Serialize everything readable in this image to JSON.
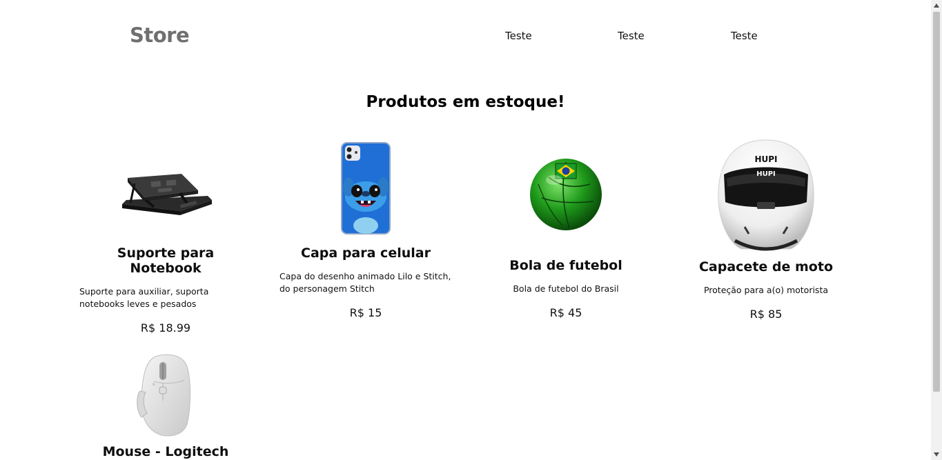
{
  "header": {
    "logo": "Store",
    "nav": [
      "Teste",
      "Teste",
      "Teste"
    ]
  },
  "main": {
    "title": "Produtos em estoque!"
  },
  "products": [
    {
      "name": "Suporte para Notebook",
      "description": "Suporte para auxiliar, suporta notebooks leves e pesados",
      "price": "R$ 18.99",
      "image_icon": "notebook-stand-icon"
    },
    {
      "name": "Capa para celular",
      "description": "Capa do desenho animado Lilo e Stitch, do personagem Stitch",
      "price": "R$ 15",
      "image_icon": "phone-case-icon"
    },
    {
      "name": "Bola de futebol",
      "description": "Bola de futebol do Brasil",
      "price": "R$ 45",
      "image_icon": "soccer-ball-icon"
    },
    {
      "name": "Capacete de moto",
      "description": "Proteção para a(o) motorista",
      "price": "R$ 85",
      "image_icon": "helmet-icon",
      "helmet_brand": "HUPI"
    },
    {
      "name": "Mouse - Logitech",
      "image_icon": "mouse-icon"
    }
  ],
  "colors": {
    "logo": "#6f6f6f",
    "text": "#111111",
    "background": "#ffffff",
    "scrollbar_track": "#f1f1f1",
    "scrollbar_thumb": "#c1c1c1"
  }
}
